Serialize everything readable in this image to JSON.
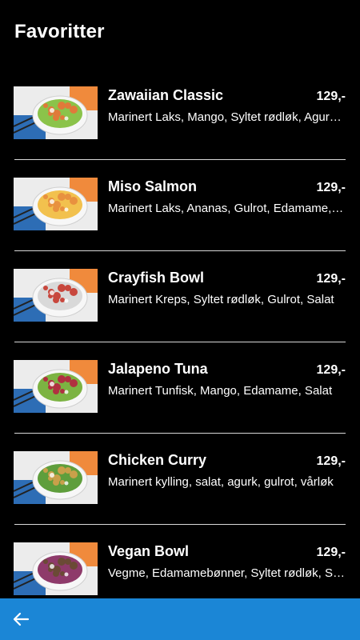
{
  "header": {
    "title": "Favoritter"
  },
  "items": [
    {
      "name": "Zawaiian Classic",
      "price": "129,-",
      "desc": "Marinert Laks, Mango, Syltet rødløk, Agurk, Edamame",
      "colors": {
        "protein": "#e07a3a",
        "topping": "#8bc34a"
      }
    },
    {
      "name": "Miso Salmon",
      "price": "129,-",
      "desc": "Marinert Laks, Ananas, Gulrot, Edamame, Salat",
      "colors": {
        "protein": "#e8913f",
        "topping": "#f2c14e"
      }
    },
    {
      "name": "Crayfish Bowl",
      "price": "129,-",
      "desc": "Marinert Kreps, Syltet rødløk, Gulrot, Salat",
      "colors": {
        "protein": "#c8473d",
        "topping": "#d9d9d9"
      }
    },
    {
      "name": "Jalapeno Tuna",
      "price": "129,-",
      "desc": "Marinert Tunfisk, Mango, Edamame, Salat",
      "colors": {
        "protein": "#b03040",
        "topping": "#7cb342"
      }
    },
    {
      "name": "Chicken Curry",
      "price": "129,-",
      "desc": "Marinert kylling, salat, agurk, gulrot, vårløk",
      "colors": {
        "protein": "#c9a04a",
        "topping": "#5f9e3c"
      }
    },
    {
      "name": "Vegan Bowl",
      "price": "129,-",
      "desc": "Vegme, Edamamebønner, Syltet rødløk, Salat",
      "colors": {
        "protein": "#6b4a35",
        "topping": "#8e3a6a"
      }
    }
  ],
  "bottom_bar": {
    "back_icon": "arrow-left-icon",
    "color": "#1b86d6"
  }
}
